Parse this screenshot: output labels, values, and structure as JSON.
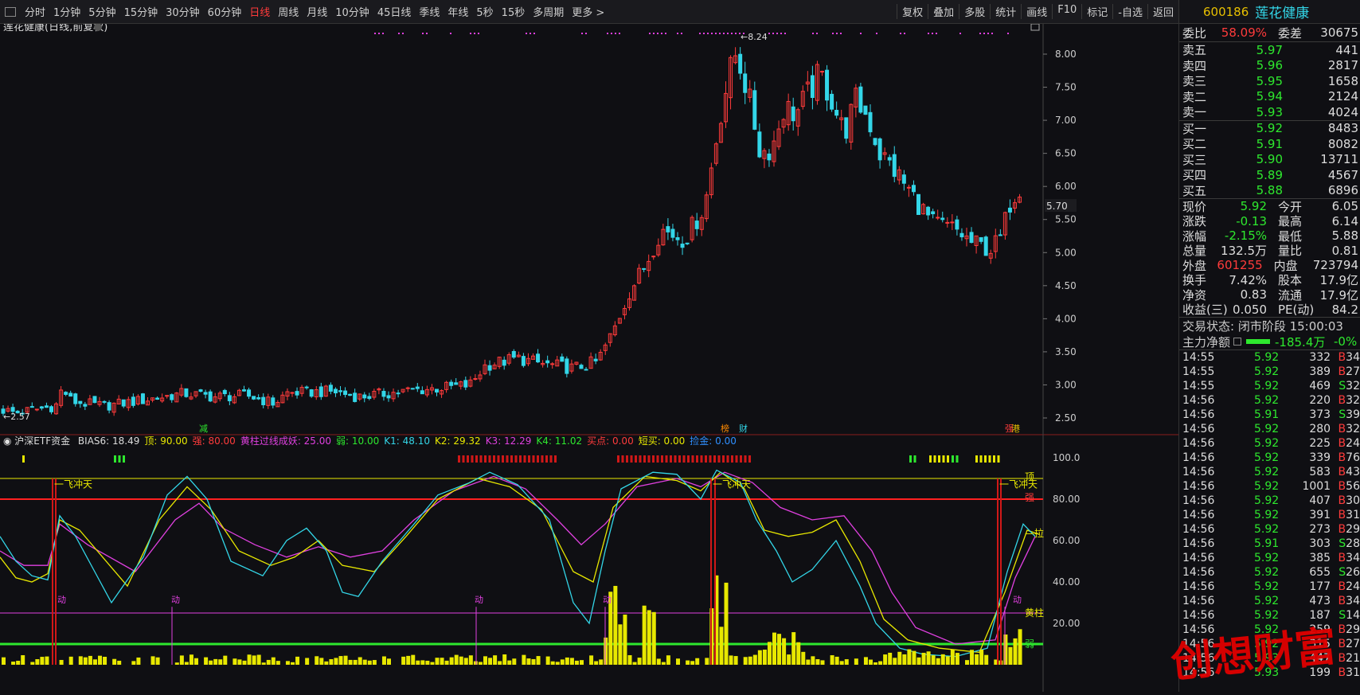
{
  "toolbar": {
    "periods": [
      "分时",
      "1分钟",
      "5分钟",
      "15分钟",
      "30分钟",
      "60分钟",
      "日线",
      "周线",
      "月线",
      "10分钟",
      "45日线",
      "季线",
      "年线",
      "5秒",
      "15秒",
      "多周期",
      "更多 >"
    ],
    "active": "日线",
    "tools": [
      "复权",
      "叠加",
      "多股",
      "统计",
      "画线",
      "F10",
      "标记",
      "-自选",
      "返回"
    ]
  },
  "main_chart": {
    "title": "莲花健康(日线,前复权)",
    "high_label": "8.24",
    "low_label": "2.57",
    "current_label": "5.70",
    "y_ticks": [
      "8.00",
      "7.50",
      "7.00",
      "6.50",
      "6.00",
      "5.50",
      "5.00",
      "4.50",
      "4.00",
      "3.50",
      "3.00",
      "2.50"
    ],
    "markers": [
      {
        "text": "减",
        "color": "#2ee82e"
      },
      {
        "text": "榜",
        "color": "#ff8a00"
      },
      {
        "text": "财",
        "color": "#33d6e8"
      },
      {
        "text": "强",
        "color": "#ff3b3b"
      },
      {
        "text": "港",
        "color": "#e8c000"
      }
    ],
    "colors": {
      "up": "#ff3b3b",
      "down": "#33d6e8"
    }
  },
  "indicator": {
    "name": "沪深ETF资金",
    "params": [
      {
        "label": "BIAS6: 18.49",
        "color": "#dddddd"
      },
      {
        "label": "顶: 90.00",
        "color": "#e8e800"
      },
      {
        "label": "强: 80.00",
        "color": "#ff3b3b"
      },
      {
        "label": "黄柱过线成妖: 25.00",
        "color": "#e040e0"
      },
      {
        "label": "弱: 10.00",
        "color": "#2ee82e"
      },
      {
        "label": "K1: 48.10",
        "color": "#33d6e8"
      },
      {
        "label": "K2: 29.32",
        "color": "#e8e800"
      },
      {
        "label": "K3: 12.29",
        "color": "#e040e0"
      },
      {
        "label": "K4: 11.02",
        "color": "#2ee82e"
      },
      {
        "label": "买点: 0.00",
        "color": "#ff3b3b"
      },
      {
        "label": "短买: 0.00",
        "color": "#e8e800"
      },
      {
        "label": "捡金: 0.00",
        "color": "#2f8fff"
      }
    ],
    "y_ticks": [
      "100.0",
      "80.00",
      "60.00",
      "40.00",
      "20.00"
    ],
    "labels": {
      "feichong": "一飞冲天",
      "ding": "顶",
      "qiang": "强",
      "la": "拉",
      "huangzhu": "黄柱",
      "ruo": "弱",
      "dong": "动"
    }
  },
  "quote": {
    "code": "600186",
    "name": "莲花健康",
    "weibi": {
      "label": "委比",
      "value": "58.09%",
      "label2": "委差",
      "value2": "30675"
    },
    "asks": [
      {
        "label": "卖五",
        "price": "5.97",
        "vol": "441"
      },
      {
        "label": "卖四",
        "price": "5.96",
        "vol": "2817"
      },
      {
        "label": "卖三",
        "price": "5.95",
        "vol": "1658"
      },
      {
        "label": "卖二",
        "price": "5.94",
        "vol": "2124"
      },
      {
        "label": "卖一",
        "price": "5.93",
        "vol": "4024"
      }
    ],
    "bids": [
      {
        "label": "买一",
        "price": "5.92",
        "vol": "8483"
      },
      {
        "label": "买二",
        "price": "5.91",
        "vol": "8082"
      },
      {
        "label": "买三",
        "price": "5.90",
        "vol": "13711"
      },
      {
        "label": "买四",
        "price": "5.89",
        "vol": "4567"
      },
      {
        "label": "买五",
        "price": "5.88",
        "vol": "6896"
      }
    ],
    "stats": [
      {
        "l1": "现价",
        "v1": "5.92",
        "c1": "grn",
        "l2": "今开",
        "v2": "6.05",
        "c2": "wht"
      },
      {
        "l1": "涨跌",
        "v1": "-0.13",
        "c1": "grn",
        "l2": "最高",
        "v2": "6.14",
        "c2": "red"
      },
      {
        "l1": "涨幅",
        "v1": "-2.15%",
        "c1": "grn",
        "l2": "最低",
        "v2": "5.88",
        "c2": "grn"
      },
      {
        "l1": "总量",
        "v1": "132.5万",
        "c1": "wht",
        "l2": "量比",
        "v2": "0.81",
        "c2": "wht"
      },
      {
        "l1": "外盘",
        "v1": "601255",
        "c1": "red",
        "l2": "内盘",
        "v2": "723794",
        "c2": "grn"
      },
      {
        "l1": "换手",
        "v1": "7.42%",
        "c1": "wht",
        "l2": "股本",
        "v2": "17.9亿",
        "c2": "wht"
      },
      {
        "l1": "净资",
        "v1": "0.83",
        "c1": "wht",
        "l2": "流通",
        "v2": "17.9亿",
        "c2": "wht"
      },
      {
        "l1": "收益(三)",
        "v1": "0.050",
        "c1": "wht",
        "l2": "PE(动)",
        "v2": "84.2",
        "c2": "wht"
      }
    ],
    "trade_status": "交易状态: 闭市阶段 15:00:03",
    "main_flow": {
      "label": "主力净额",
      "value": "-185.4万",
      "pct": "-0%"
    }
  },
  "ticks": [
    {
      "t": "14:55",
      "p": "5.92",
      "c": "grn",
      "v": "332",
      "vc": "wht",
      "bs": "B",
      "x": "34"
    },
    {
      "t": "14:55",
      "p": "5.92",
      "c": "grn",
      "v": "389",
      "vc": "wht",
      "bs": "B",
      "x": "27"
    },
    {
      "t": "14:55",
      "p": "5.92",
      "c": "grn",
      "v": "469",
      "vc": "wht",
      "bs": "S",
      "x": "32"
    },
    {
      "t": "14:56",
      "p": "5.92",
      "c": "grn",
      "v": "220",
      "vc": "wht",
      "bs": "B",
      "x": "32"
    },
    {
      "t": "14:56",
      "p": "5.91",
      "c": "grn",
      "v": "373",
      "vc": "wht",
      "bs": "S",
      "x": "39"
    },
    {
      "t": "14:56",
      "p": "5.92",
      "c": "grn",
      "v": "280",
      "vc": "wht",
      "bs": "B",
      "x": "32"
    },
    {
      "t": "14:56",
      "p": "5.92",
      "c": "grn",
      "v": "225",
      "vc": "wht",
      "bs": "B",
      "x": "24"
    },
    {
      "t": "14:56",
      "p": "5.92",
      "c": "grn",
      "v": "339",
      "vc": "wht",
      "bs": "B",
      "x": "76"
    },
    {
      "t": "14:56",
      "p": "5.92",
      "c": "grn",
      "v": "583",
      "vc": "mag",
      "bs": "B",
      "x": "43"
    },
    {
      "t": "14:56",
      "p": "5.92",
      "c": "grn",
      "v": "1001",
      "vc": "mag",
      "bs": "B",
      "x": "56"
    },
    {
      "t": "14:56",
      "p": "5.92",
      "c": "grn",
      "v": "407",
      "vc": "wht",
      "bs": "B",
      "x": "30"
    },
    {
      "t": "14:56",
      "p": "5.92",
      "c": "grn",
      "v": "391",
      "vc": "wht",
      "bs": "B",
      "x": "31"
    },
    {
      "t": "14:56",
      "p": "5.92",
      "c": "grn",
      "v": "273",
      "vc": "wht",
      "bs": "B",
      "x": "29"
    },
    {
      "t": "14:56",
      "p": "5.91",
      "c": "grn",
      "v": "303",
      "vc": "wht",
      "bs": "S",
      "x": "28"
    },
    {
      "t": "14:56",
      "p": "5.92",
      "c": "grn",
      "v": "385",
      "vc": "wht",
      "bs": "B",
      "x": "34"
    },
    {
      "t": "14:56",
      "p": "5.92",
      "c": "grn",
      "v": "655",
      "vc": "mag",
      "bs": "S",
      "x": "26"
    },
    {
      "t": "14:56",
      "p": "5.92",
      "c": "grn",
      "v": "177",
      "vc": "wht",
      "bs": "B",
      "x": "24"
    },
    {
      "t": "14:56",
      "p": "5.92",
      "c": "grn",
      "v": "473",
      "vc": "wht",
      "bs": "B",
      "x": "34"
    },
    {
      "t": "14:56",
      "p": "5.92",
      "c": "grn",
      "v": "187",
      "vc": "wht",
      "bs": "S",
      "x": "14"
    },
    {
      "t": "14:56",
      "p": "5.92",
      "c": "grn",
      "v": "259",
      "vc": "wht",
      "bs": "B",
      "x": "29"
    },
    {
      "t": "14:56",
      "p": "5.92",
      "c": "grn",
      "v": "315",
      "vc": "wht",
      "bs": "B",
      "x": "27"
    },
    {
      "t": "14:56",
      "p": "5.93",
      "c": "grn",
      "v": "447",
      "vc": "wht",
      "bs": "B",
      "x": "21"
    },
    {
      "t": "14:56",
      "p": "5.93",
      "c": "grn",
      "v": "199",
      "vc": "wht",
      "bs": "B",
      "x": "31"
    }
  ],
  "watermark": "创想财富"
}
